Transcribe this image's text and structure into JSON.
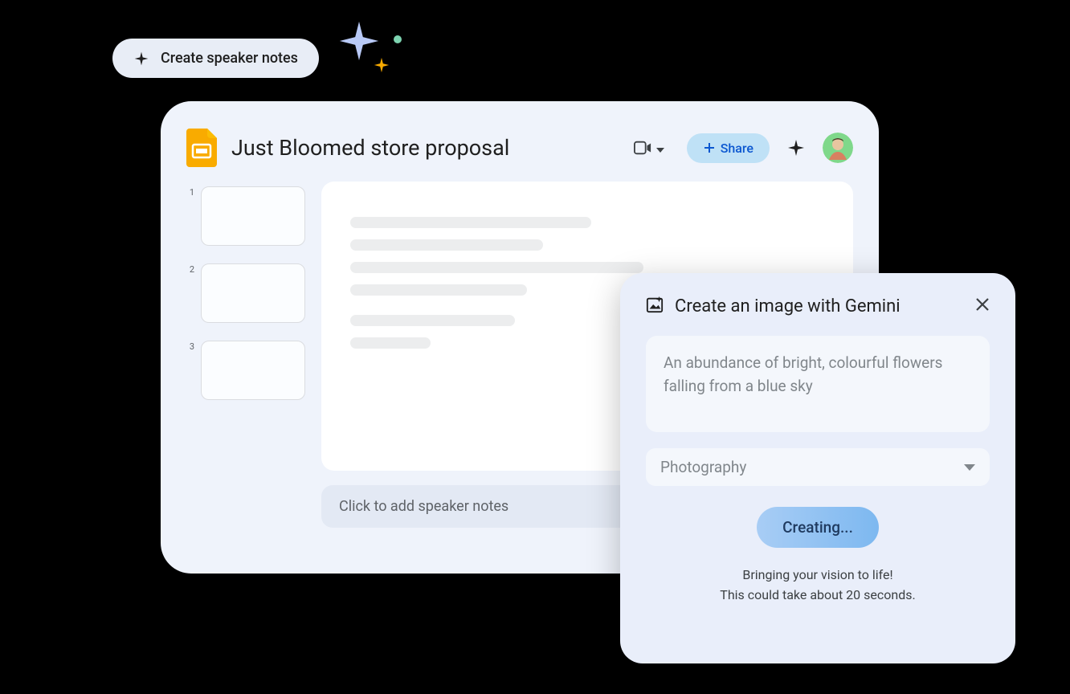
{
  "chip": {
    "label": "Create speaker notes"
  },
  "slides": {
    "title": "Just Bloomed store proposal",
    "share_label": "Share",
    "thumbnails": [
      "1",
      "2",
      "3"
    ],
    "notes_placeholder": "Click to add speaker notes"
  },
  "gemini": {
    "title": "Create an image with Gemini",
    "prompt": "An abundance of bright, colourful flowers falling from a blue sky",
    "style": "Photography",
    "button_label": "Creating...",
    "status_line1": "Bringing your vision to life!",
    "status_line2": "This could take about 20 seconds."
  }
}
